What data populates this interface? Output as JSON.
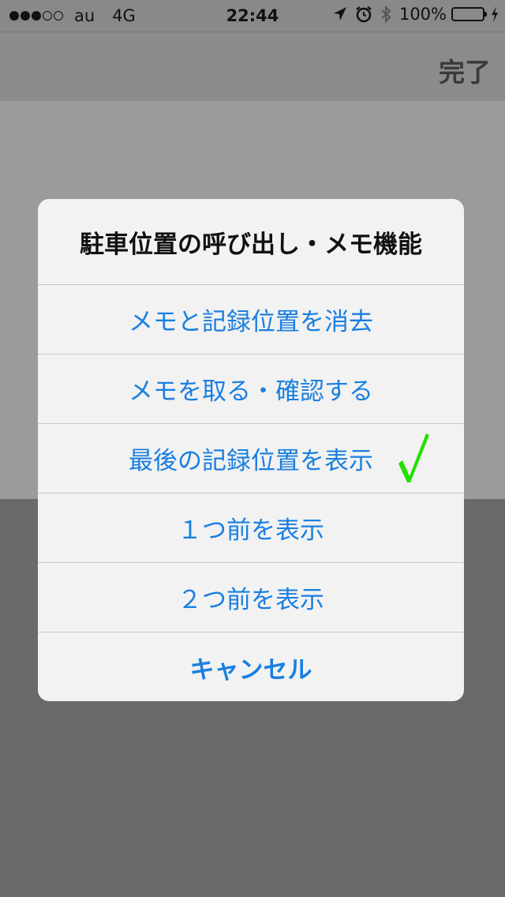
{
  "status_bar": {
    "signal_dots_filled": 3,
    "signal_dots_total": 5,
    "carrier": "au",
    "network": "4G",
    "time": "22:44",
    "battery_percent": "100%",
    "battery_level": 1.0,
    "icons": [
      "location-arrow-icon",
      "alarm-icon",
      "bluetooth-icon",
      "charging-bolt-icon"
    ]
  },
  "nav": {
    "done_label": "完了"
  },
  "action_sheet": {
    "title": "駐車位置の呼び出し・メモ機能",
    "items": [
      {
        "label": "メモと記録位置を消去",
        "checked": false
      },
      {
        "label": "メモを取る・確認する",
        "checked": false
      },
      {
        "label": "最後の記録位置を表示",
        "checked": true
      },
      {
        "label": "１つ前を表示",
        "checked": false
      },
      {
        "label": "２つ前を表示",
        "checked": false
      }
    ],
    "cancel_label": "キャンセル"
  },
  "colors": {
    "accent": "#1a7fe0",
    "check": "#22e000",
    "battery": "#4cd964"
  }
}
